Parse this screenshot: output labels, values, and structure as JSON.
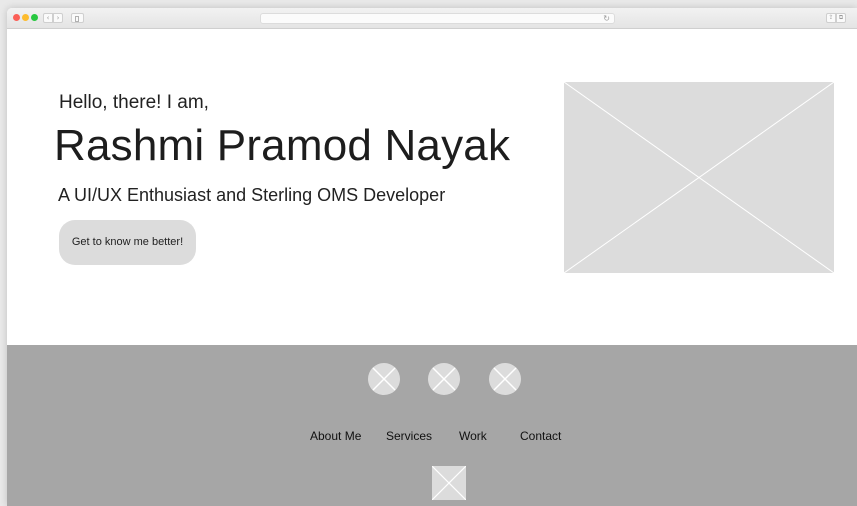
{
  "browser": {
    "nav_back": "‹",
    "nav_forward": "›",
    "reload": "↻",
    "share": "⇪",
    "tabs": "⧉",
    "icons": [
      "close",
      "minimize",
      "maximize",
      "chevron-left-icon",
      "chevron-right-icon",
      "sidebar-icon",
      "reload-icon",
      "share-icon",
      "tabs-icon"
    ]
  },
  "hero": {
    "greeting": "Hello, there! I am,",
    "name": "Rashmi Pramod Nayak",
    "subtitle": "A UI/UX Enthusiast and Sterling OMS Developer",
    "cta_label": "Get to know me better!",
    "image_placeholder": "image-placeholder-icon"
  },
  "footer": {
    "social_icons": [
      "social-placeholder-icon",
      "social-placeholder-icon",
      "social-placeholder-icon"
    ],
    "links": [
      {
        "label": "About Me"
      },
      {
        "label": "Services"
      },
      {
        "label": "Work"
      },
      {
        "label": "Contact"
      }
    ],
    "logo": "logo-placeholder-icon"
  },
  "colors": {
    "placeholder_gray": "#dcdcdc",
    "footer_gray": "#a6a6a6",
    "placeholder_lines": "#ffffff",
    "text": "#222222"
  }
}
